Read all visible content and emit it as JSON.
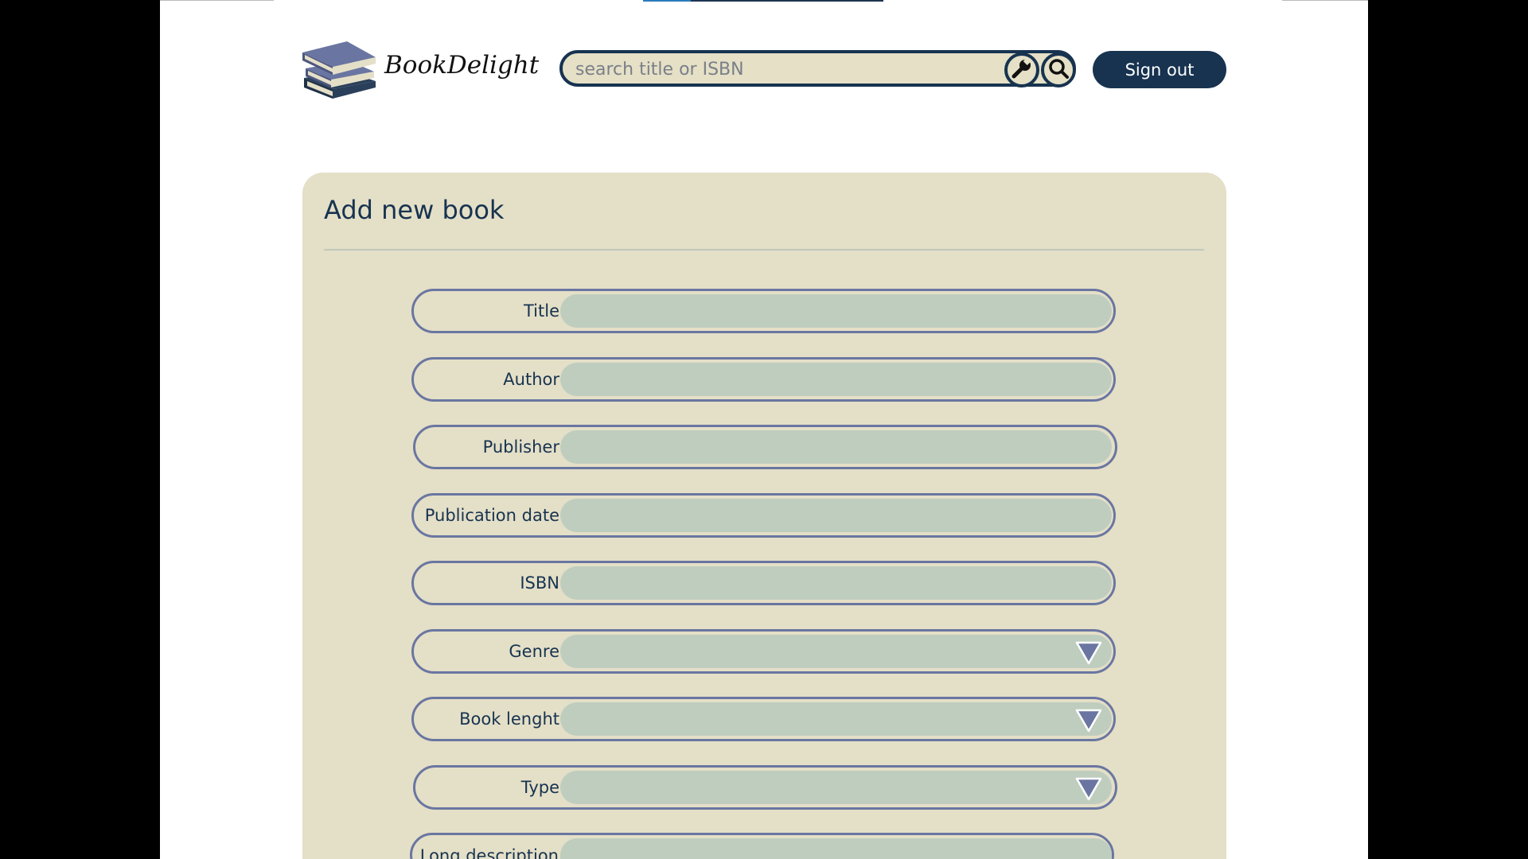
{
  "brand": {
    "name": "BookDelight"
  },
  "search": {
    "placeholder": "search title or ISBN"
  },
  "header": {
    "signout_label": "Sign out"
  },
  "form": {
    "title": "Add new book",
    "fields": [
      {
        "label": "Title",
        "type": "text"
      },
      {
        "label": "Author",
        "type": "text"
      },
      {
        "label": "Publisher",
        "type": "text"
      },
      {
        "label": "Publication date",
        "type": "text"
      },
      {
        "label": "ISBN",
        "type": "text"
      },
      {
        "label": "Genre",
        "type": "select"
      },
      {
        "label": "Book lenght",
        "type": "select"
      },
      {
        "label": "Type",
        "type": "select"
      },
      {
        "label": "Long description",
        "type": "textarea"
      }
    ]
  },
  "icons": {
    "logo": "book-stack-icon",
    "wrench": "wrench-icon",
    "search": "search-icon",
    "dropdown": "triangle-down-icon"
  },
  "colors": {
    "navy": "#173350",
    "card_bg": "#e4dfc7",
    "input_bg": "#bfcdbf",
    "field_border": "#6a76a1",
    "page_bg": "#ffffff",
    "outer_bg": "#000000"
  }
}
